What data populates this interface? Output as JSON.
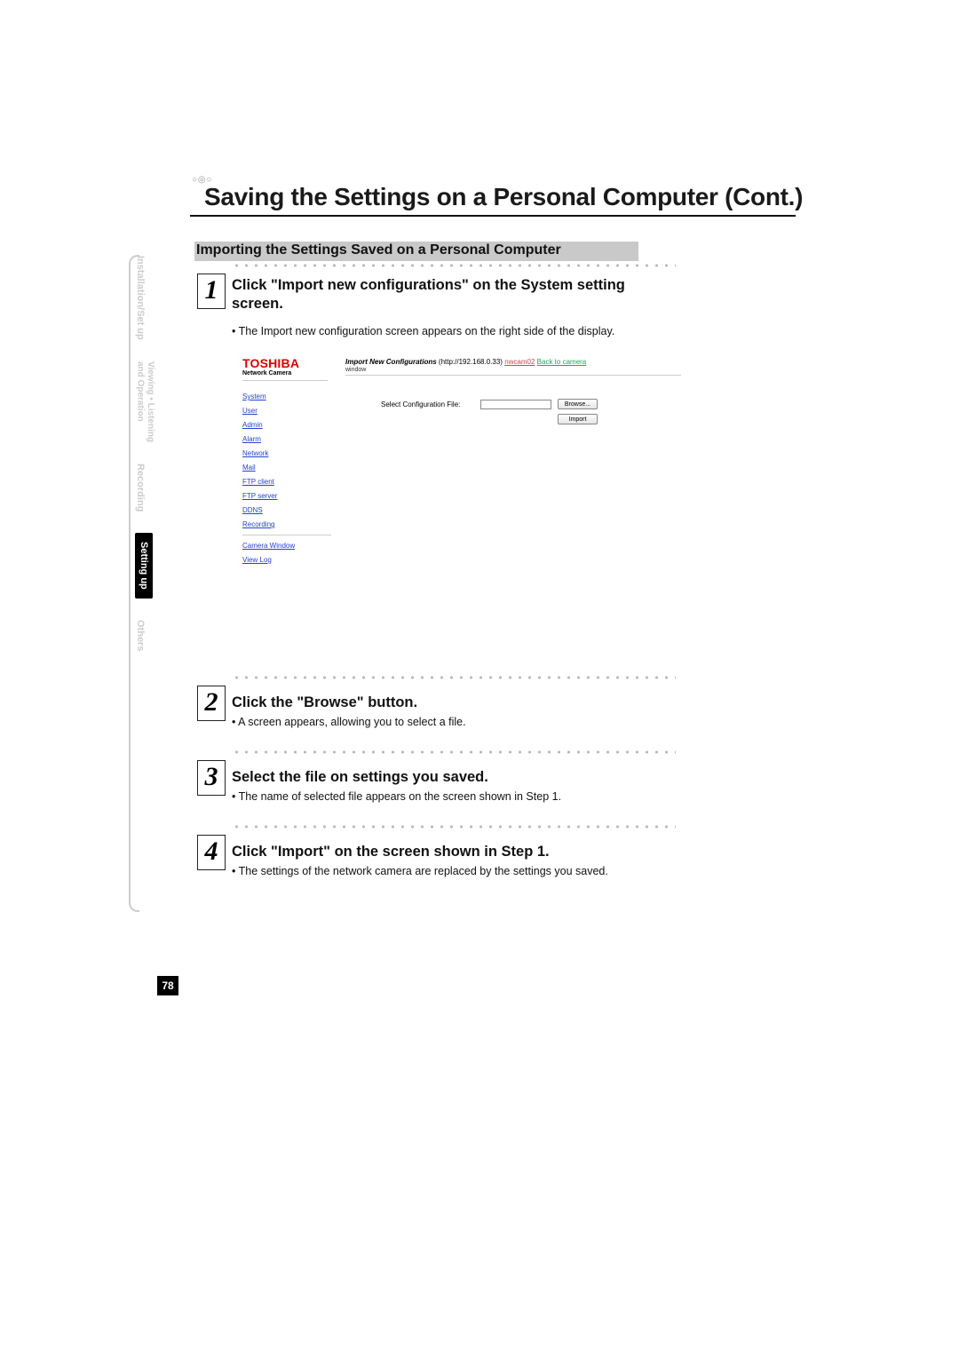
{
  "header": {
    "title": "Saving the Settings on a Personal Computer (Cont.)"
  },
  "section": {
    "heading": "Importing the Settings Saved on a Personal Computer"
  },
  "steps": [
    {
      "num": "1",
      "title": "Click \"Import new configurations\" on the System setting screen.",
      "body": "The Import new configuration screen appears on the right side of the display."
    },
    {
      "num": "2",
      "title": "Click the \"Browse\" button.",
      "body": "A screen appears, allowing you to select a file."
    },
    {
      "num": "3",
      "title": "Select the file on settings you saved.",
      "body": "The name of selected file appears on the screen shown in Step 1."
    },
    {
      "num": "4",
      "title": "Click \"Import\" on the screen shown in Step 1.",
      "body": "The settings of the network camera are replaced by the settings you saved."
    }
  ],
  "screenshot": {
    "brand": "TOSHIBA",
    "brand_sub": "Network Camera",
    "title_bold": "Import New Configurations",
    "title_url": "(http://192.168.0.33) ",
    "title_cam": "nwcam02",
    "title_back": "Back to camera",
    "title_sub": "window",
    "nav": [
      "System",
      "User",
      "Admin",
      "Alarm",
      "Network",
      "Mail",
      "FTP client",
      "FTP server",
      "DDNS",
      "Recording"
    ],
    "nav2": [
      "Camera Window",
      "View Log"
    ],
    "label": "Select Configuration File:",
    "btn_browse": "Browse...",
    "btn_import": "Import"
  },
  "side": {
    "tabs": [
      "Installation/Set up",
      "Viewing • Listening\nand Operation",
      "Recording",
      "Setting up",
      "Others"
    ]
  },
  "pagenum": "78"
}
